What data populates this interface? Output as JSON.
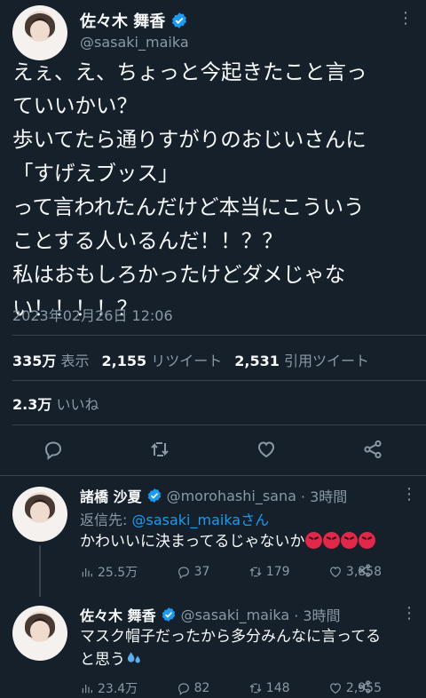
{
  "main_tweet": {
    "display_name": "佐々木 舞香",
    "handle": "@sasaki_maika",
    "text_lines": [
      "えぇ、え、ちょっと今起きたこと言っ",
      "ていいかい？",
      "歩いてたら通りすがりのおじいさんに",
      "「すげえブッス」",
      "って言われたんだけど本当にこういう",
      "ことする人いるんだ！！？？",
      "私はおもしろかったけどダメじゃな",
      "い！！！！？"
    ],
    "timestamp": "2023年02月26日 12:06",
    "stats": {
      "views_count": "335万",
      "views_label": "表示",
      "retweets_count": "2,155",
      "retweets_label": "リツイート",
      "quotes_count": "2,531",
      "quotes_label": "引用ツイート",
      "likes_count": "2.3万",
      "likes_label": "いいね"
    }
  },
  "replies": [
    {
      "display_name": "諸橋 沙夏",
      "handle": "@morohashi_sana",
      "time": "· 3時間",
      "reply_to_prefix": "返信先: ",
      "reply_to_handle": "@sasaki_maika",
      "reply_to_suffix": "さん",
      "text": "かわいいに決まってるじゃないか",
      "emojis": [
        "angry-face",
        "angry-face",
        "angry-face",
        "angry-face"
      ],
      "metrics": {
        "views": "25.5万",
        "replies": "37",
        "retweets": "179",
        "likes": "3,858"
      }
    },
    {
      "display_name": "佐々木 舞香",
      "handle": "@sasaki_maika",
      "time": "· 3時間",
      "text_lines": [
        "マスク帽子だったから多分みんなに言ってる",
        "と思う"
      ],
      "emojis": [
        "sweat-droplets"
      ],
      "metrics": {
        "views": "23.4万",
        "replies": "82",
        "retweets": "148",
        "likes": "2,955"
      }
    }
  ],
  "colors": {
    "background": "#15202b",
    "text": "#f7f9f9",
    "muted": "#8b98a5",
    "verified": "#1d9bf0",
    "link": "#1d9bf0",
    "divider": "#38444d"
  }
}
